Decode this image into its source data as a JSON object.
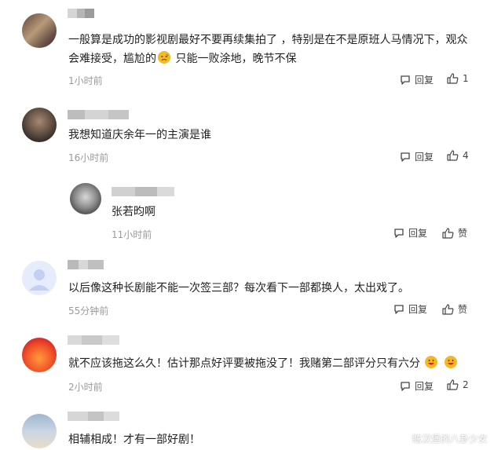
{
  "comments": [
    {
      "text_a": "一般算是成功的影视剧最好不要再续集拍了 ，特别是在不是原班人马情况下，观众会难接受，尴尬的",
      "text_b": "只能一败涂地，晚节不保",
      "time": "1小时前",
      "reply_label": "回复",
      "likes": "1",
      "emoji": "sad-face-icon"
    },
    {
      "text": "我想知道庆余年一的主演是谁",
      "time": "16小时前",
      "reply_label": "回复",
      "likes": "4"
    },
    {
      "text": "张若昀啊",
      "time": "11小时前",
      "reply_label": "回复",
      "likes": "赞"
    },
    {
      "text": "以后像这种长剧能不能一次签三部？每次看下一部都换人，太出戏了。",
      "time": "55分钟前",
      "reply_label": "回复",
      "likes": "赞"
    },
    {
      "text": "就不应该拖这么久！估计那点好评要被拖没了！我赌第二部评分只有六分",
      "time": "2小时前",
      "reply_label": "回复",
      "likes": "2",
      "emoji": "grinning-face-icon"
    },
    {
      "text": "相辅相成！才有一部好剧！"
    }
  ],
  "watermark": "眩汉堡的八卦少女",
  "colors": {
    "text": "#222222",
    "meta": "#9a9a9a",
    "action": "#444444",
    "emoji_yellow": "#f5b820"
  }
}
